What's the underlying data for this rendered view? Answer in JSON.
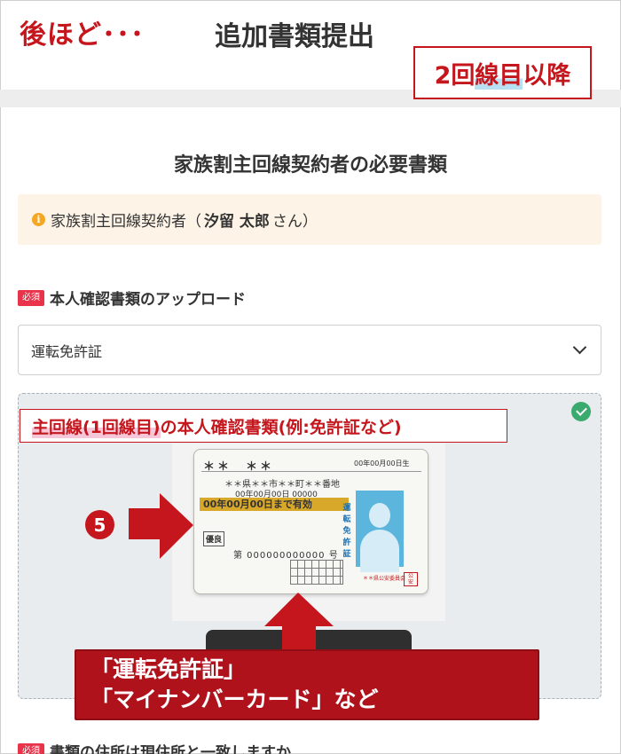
{
  "header": {
    "later_label": "後ほど･･･",
    "title": "追加書類提出",
    "line_prefix": "2回",
    "line_highlight": "線目",
    "line_suffix": "以降"
  },
  "section": {
    "title": "家族割主回線契約者の必要書類"
  },
  "contract_note": {
    "prefix": "家族割主回線契約者（",
    "name": "汐留 太郎",
    "suffix": "さん）"
  },
  "upload_section": {
    "required_badge": "必須",
    "heading": "本人確認書類のアップロード",
    "select_value": "運転免許証"
  },
  "id_doc_label": {
    "highlight": "主回線(1回線目)",
    "rest": "の本人確認書類(例:免許証など)"
  },
  "license_card": {
    "name": "＊＊　＊＊",
    "birth": "00年00月00日生",
    "address": "＊＊県＊＊市＊＊町＊＊番地",
    "date": "00年00月00日 00000",
    "valid_until": "00年00月00日まで有効",
    "condition": "優良",
    "number": "第 000000000000 号",
    "vertical_text": "運転免許証",
    "issuer": "＊＊県公安委員会"
  },
  "step_number": "5",
  "doc_callout": {
    "line1": "「運転免許証」",
    "line2": "「マイナンバーカード」など"
  },
  "next_section": {
    "required_badge": "必須",
    "heading": "書類の住所は現住所と一致しますか"
  },
  "colors": {
    "accent_red": "#c4161c",
    "required_pink": "#e8334a",
    "note_bg": "#fdf3e6",
    "success_green": "#3aaa6e"
  },
  "icons": [
    "info-icon",
    "chevron-down-icon",
    "check-circle-icon",
    "arrow-right-icon",
    "arrow-up-icon"
  ]
}
